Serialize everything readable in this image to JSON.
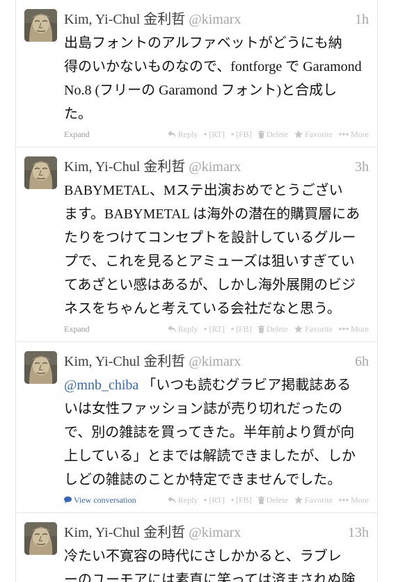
{
  "user": {
    "display_name": "Kim, Yi-Chul 金利哲",
    "handle": "@kimarx"
  },
  "colors": {
    "link": "#3466b8",
    "muted": "#a6a6a6",
    "action": "#c6c6c6",
    "border": "#e6e6e6",
    "text": "#141414"
  },
  "actions": [
    {
      "icon": "reply-icon",
      "label": "Reply"
    },
    {
      "icon": "dot-icon",
      "label": "[RT]"
    },
    {
      "icon": "dot-icon",
      "label": "[FB]"
    },
    {
      "icon": "trash-icon",
      "label": "Delete"
    },
    {
      "icon": "star-icon",
      "label": "Favorite"
    },
    {
      "icon": "more-dots-icon",
      "label": "More"
    }
  ],
  "tweets": [
    {
      "time": "1h",
      "mention": null,
      "lines": [
        "出島フォントのアルファベットがどうにも納",
        "得のいかないものなので、fontforge で Garamond",
        "No.8 (フリーの Garamond フォント)と合成し",
        "た。"
      ],
      "footer_link": "Expand",
      "footer_icon": null
    },
    {
      "time": "3h",
      "mention": null,
      "lines": [
        "BABYMETAL、Mステ出演おめでとうござい",
        "ます。BABYMETAL は海外の潜在的購買層にあ",
        "たりをつけてコンセプトを設計しているグルー",
        "プで、これを見るとアミューズは狙いすぎてい",
        "てあざとい感はあるが、しかし海外展開のビジ",
        "ネスをちゃんと考えている会社だなと思う。"
      ],
      "footer_link": "Expand",
      "footer_icon": null
    },
    {
      "time": "6h",
      "mention": "@mnb_chiba",
      "lines": [
        "「いつも読むグラビア掲載誌ある",
        "いは女性ファッション誌が売り切れだったの",
        "で、別の雑誌を買ってきた。半年前より質が向",
        "上している」とまでは解読できましたが、しか",
        "しどの雑誌のことか特定できませんでした。"
      ],
      "footer_link": "View conversation",
      "footer_icon": "speech-bubble-icon"
    },
    {
      "time": "13h",
      "mention": null,
      "lines": [
        "冷たい不寛容の時代にさしかかると、ラブレ",
        "ーのユーモアには素直に笑っては済まされぬ険"
      ],
      "footer_link": null,
      "footer_icon": null
    }
  ]
}
